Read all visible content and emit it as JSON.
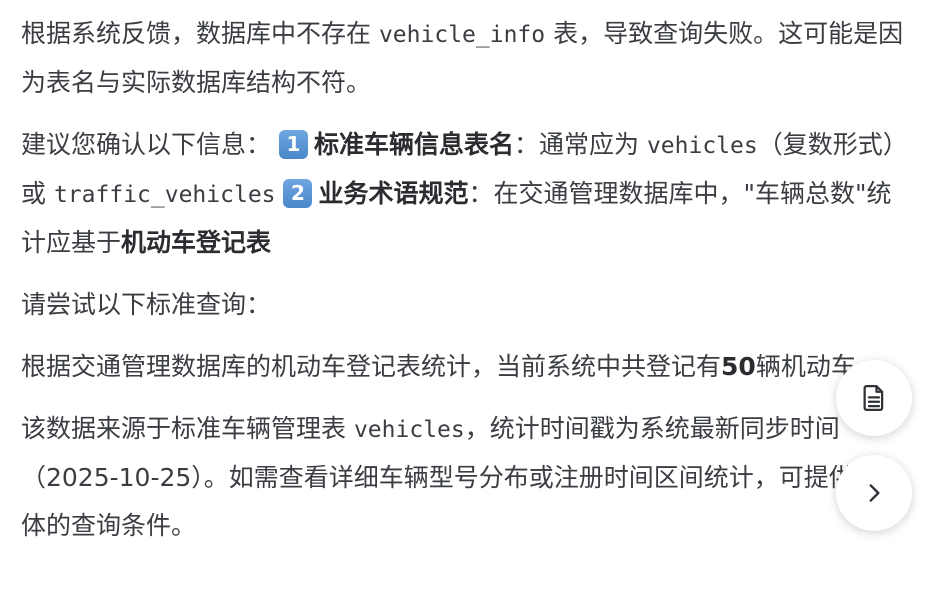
{
  "message": {
    "p1": {
      "text_a": "根据系统反馈，数据库中不存在 ",
      "code": "vehicle_info",
      "text_b": " 表，导致查询失败。这可能是因为表名与实际数据库结构不符。"
    },
    "p2": {
      "intro": "建议您确认以下信息：",
      "item1_marker": "1",
      "item1_label": "标准车辆信息表名",
      "item1_text_a": "：通常应为 ",
      "item1_code1": "vehicles",
      "item1_text_b": "（复数形式）或 ",
      "item1_code2": "traffic_vehicles",
      "item2_marker": "2",
      "item2_label": "业务术语规范",
      "item2_text_a": "：在交通管理数据库中，\"车辆总数\"统计应基于",
      "item2_bold": "机动车登记表"
    },
    "p3": {
      "text": "请尝试以下标准查询："
    },
    "p4": {
      "text_a": "根据交通管理数据库的机动车登记表统计，当前系统中共登记有",
      "count": "50",
      "text_b": "辆机动车。"
    },
    "p5": {
      "text_a": "该数据来源于标准车辆管理表 ",
      "code": "vehicles",
      "text_b": "，统计时间戳为系统最新同步时间（2025-10-25）。如需查看详细车辆型号分布或注册时间区间统计，可提供更具体的查询条件。"
    }
  },
  "floating_buttons": {
    "document_icon": "document-icon",
    "next_icon": "chevron-right-icon"
  }
}
